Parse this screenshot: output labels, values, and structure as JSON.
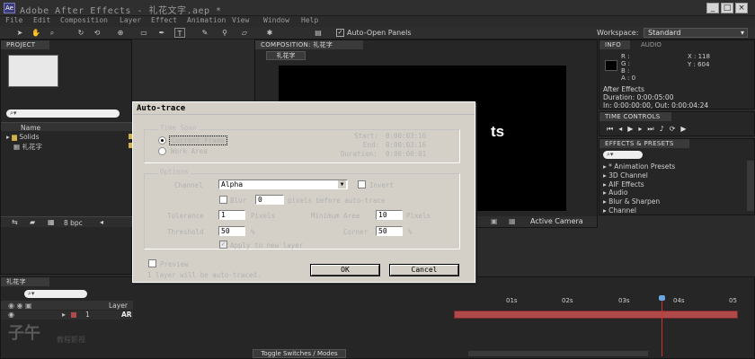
{
  "window": {
    "title": "Adobe After Effects - 礼花文字.aep *",
    "app_icon": "Ae",
    "minimize": "_",
    "maximize": "□",
    "close": "×"
  },
  "menu": [
    "File",
    "Edit",
    "Composition",
    "Layer",
    "Effect",
    "Animation",
    "View",
    "Window",
    "Help"
  ],
  "toolbar": {
    "auto_open_panels": "Auto-Open Panels",
    "workspace_label": "Workspace:",
    "workspace_value": "Standard"
  },
  "project": {
    "tab": "PROJECT",
    "columns": {
      "name": "Name"
    },
    "items": [
      {
        "label": "Solids"
      },
      {
        "label": "礼花字"
      }
    ],
    "bpc": "8 bpc"
  },
  "composition": {
    "tab": "COMPOSITION: 礼花字",
    "comp_tab": "礼花字",
    "preview_text": "ts",
    "active_camera": "Active Camera"
  },
  "info": {
    "tab": "INFO",
    "audio_tab": "AUDIO",
    "r": "R :",
    "g": "G :",
    "b": "B :",
    "a": "A : 0",
    "x": "X : 118",
    "y": "Y : 604",
    "effect_title": "After Effects",
    "duration": "Duration: 0:00:05:00",
    "in_out": "In: 0:00:00:00, Out: 0:00:04:24"
  },
  "time_controls": {
    "tab": "TIME CONTROLS"
  },
  "effects": {
    "tab": "EFFECTS & PRESETS",
    "items": [
      "* Animation Presets",
      "3D Channel",
      "AIF Effects",
      "Audio",
      "Blur & Sharpen",
      "Channel"
    ]
  },
  "timeline": {
    "tab": "礼花字",
    "layer_col": "Layer",
    "layer_num": "1",
    "layer_name": "AR",
    "ticks": [
      "01s",
      "02s",
      "03s",
      "04s",
      "05"
    ],
    "toggle": "Toggle Switches / Modes"
  },
  "dialog": {
    "title": "Auto-trace",
    "time_span": {
      "legend": "Time Span",
      "current_frame": "Current Frame",
      "work_area": "Work Area",
      "start_label": "Start:",
      "start_value": "0:00:03:16",
      "end_label": "End:",
      "end_value": "0:00:03:16",
      "duration_label": "Duration:",
      "duration_value": "0:00:00:01"
    },
    "options": {
      "legend": "Options",
      "channel_label": "Channel",
      "channel_value": "Alpha",
      "invert": "Invert",
      "blur_label": "Blur",
      "blur_value": "0",
      "blur_suffix": "pixels before auto-trace",
      "tolerance_label": "Tolerance",
      "tolerance_value": "1",
      "tolerance_unit": "Pixels",
      "min_area_label": "Minimum Area",
      "min_area_value": "10",
      "min_area_unit": "Pixels",
      "threshold_label": "Threshold",
      "threshold_value": "50",
      "threshold_unit": "%",
      "corner_label": "Corner",
      "corner_value": "50",
      "corner_unit": "%",
      "apply_new_layer": "Apply to new layer"
    },
    "preview": "Preview",
    "status": "1 layer will be auto-traced.",
    "ok": "OK",
    "cancel": "Cancel"
  },
  "watermark": {
    "brand": "子午",
    "sub": "教程影视"
  },
  "colors": {
    "accent_red": "#b04a4a",
    "playhead": "#c33",
    "current_time": "#6aa6e6"
  }
}
